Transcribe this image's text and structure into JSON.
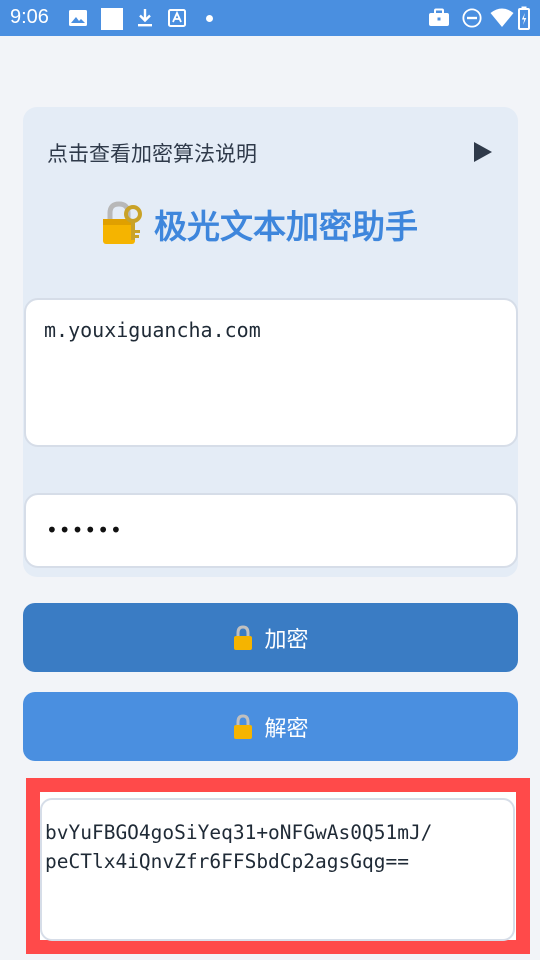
{
  "status_bar": {
    "time": "9:06",
    "left_icons": [
      "image-icon",
      "square-icon",
      "download-icon",
      "font-a-icon",
      "dot-icon"
    ],
    "right_icons": [
      "briefcase-icon",
      "dnd-icon",
      "wifi-icon",
      "signal-icon",
      "battery-icon"
    ]
  },
  "help": {
    "label": "点击查看加密算法说明",
    "expand_icon": "play-triangle-icon"
  },
  "title": {
    "icon": "lock-with-key-icon",
    "text": "极光文本加密助手"
  },
  "input": {
    "text_value": "m.youxiguancha.com",
    "password_value": "••••••"
  },
  "buttons": {
    "encrypt_label": "加密",
    "decrypt_label": "解密",
    "icon": "lock-icon"
  },
  "output": {
    "result_line1": "bvYuFBGO4goSiYeq31+oNFGwAs0Q51mJ/",
    "result_line2": "peCTlx4iQnvZfr6FFSbdCp2agsGqg=="
  },
  "colors": {
    "status_bar": "#4a8fe0",
    "accent": "#3e86dc",
    "encrypt_button": "#3a7cc4",
    "decrypt_button": "#4a8fe0",
    "highlight": "#ff4a4a",
    "card_bg": "#e4ecf6"
  }
}
